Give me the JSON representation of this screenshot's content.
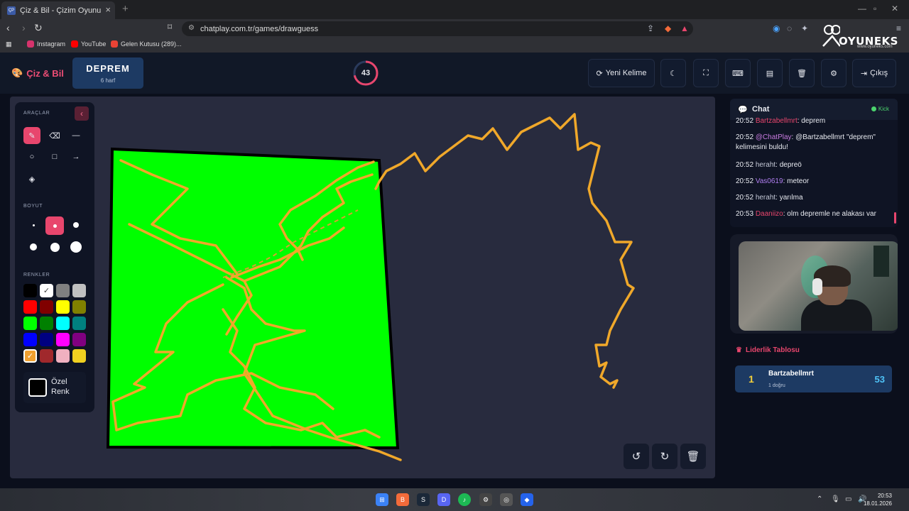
{
  "browser": {
    "tab_title": "Çiz & Bil - Çizim Oyunu",
    "tab_favicon": "ÇP",
    "url": "chatplay.com.tr/games/drawguess",
    "bookmarks": [
      {
        "label": "Instagram",
        "color": "#d6336c"
      },
      {
        "label": "YouTube",
        "color": "#ff0000"
      },
      {
        "label": "Gelen Kutusu (289)...",
        "color": "#ea4335"
      }
    ],
    "overlay_brand": "OYUNEKS",
    "overlay_site": "www.oyuneks.com"
  },
  "header": {
    "app_name": "Çiz & Bil",
    "word": "DEPREM",
    "word_hint": "6 harf",
    "timer": "43",
    "buttons": {
      "new_word": "Yeni Kelime",
      "exit": "Çıkış"
    }
  },
  "tools": {
    "section_tools": "ARAÇLAR",
    "section_size": "BOYUT",
    "section_colors": "RENKLER",
    "custom_color": "Özel Renk",
    "swatches": [
      "#000000",
      "#ffffff",
      "#808080",
      "#c0c0c0",
      "#ff0000",
      "#800000",
      "#ffff00",
      "#808000",
      "#00ff00",
      "#008000",
      "#00ffff",
      "#008080",
      "#0000ff",
      "#000080",
      "#ff00ff",
      "#800080",
      "#f0a030",
      "#a0282c",
      "#f0b0c0",
      "#f0d020"
    ]
  },
  "chat": {
    "title": "Chat",
    "status": "Kick",
    "messages": [
      {
        "time": "20:52",
        "user": "Bartzabellmrt",
        "text": ": deprem",
        "cls": "n1"
      },
      {
        "time": "20:52",
        "user": "@ChatPlay",
        "text": ": @Bartzabellmrt \"deprem\" kelimesini buldu!",
        "cls": "n2"
      },
      {
        "time": "20:52",
        "user": "heraht",
        "text": ": depreö",
        "cls": "n4"
      },
      {
        "time": "20:52",
        "user": "Vas0619",
        "text": ": meteor",
        "cls": "n3"
      },
      {
        "time": "20:52",
        "user": "heraht",
        "text": ": yarılma",
        "cls": "n4"
      },
      {
        "time": "20:53",
        "user": "Daaniizo",
        "text": ": olm depremle ne alakası var",
        "cls": "n1"
      }
    ]
  },
  "leaderboard": {
    "title": "Liderlik Tablosu",
    "rows": [
      {
        "rank": "1",
        "name": "Bartzabellmrt",
        "sub": "1 doğru",
        "score": "53"
      }
    ]
  },
  "taskbar": {
    "time": "20:53",
    "date": "18.01.2026"
  }
}
